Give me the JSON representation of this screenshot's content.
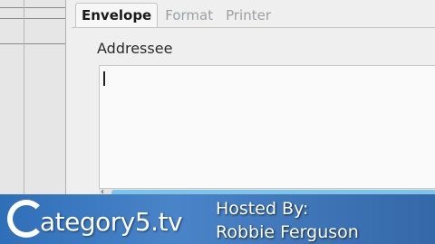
{
  "tabs": [
    {
      "label": "Envelope",
      "active": true
    },
    {
      "label": "Format",
      "active": false
    },
    {
      "label": "Printer",
      "active": false
    }
  ],
  "addressee": {
    "label": "Addressee",
    "value": ""
  },
  "banner": {
    "logo_text": "ategory5.tv",
    "hosted_line1": "Hosted By:",
    "hosted_line2": "Robbie Ferguson"
  },
  "colors": {
    "banner": "#3a78c0",
    "scroll_thumb": "#7ec3e8"
  }
}
